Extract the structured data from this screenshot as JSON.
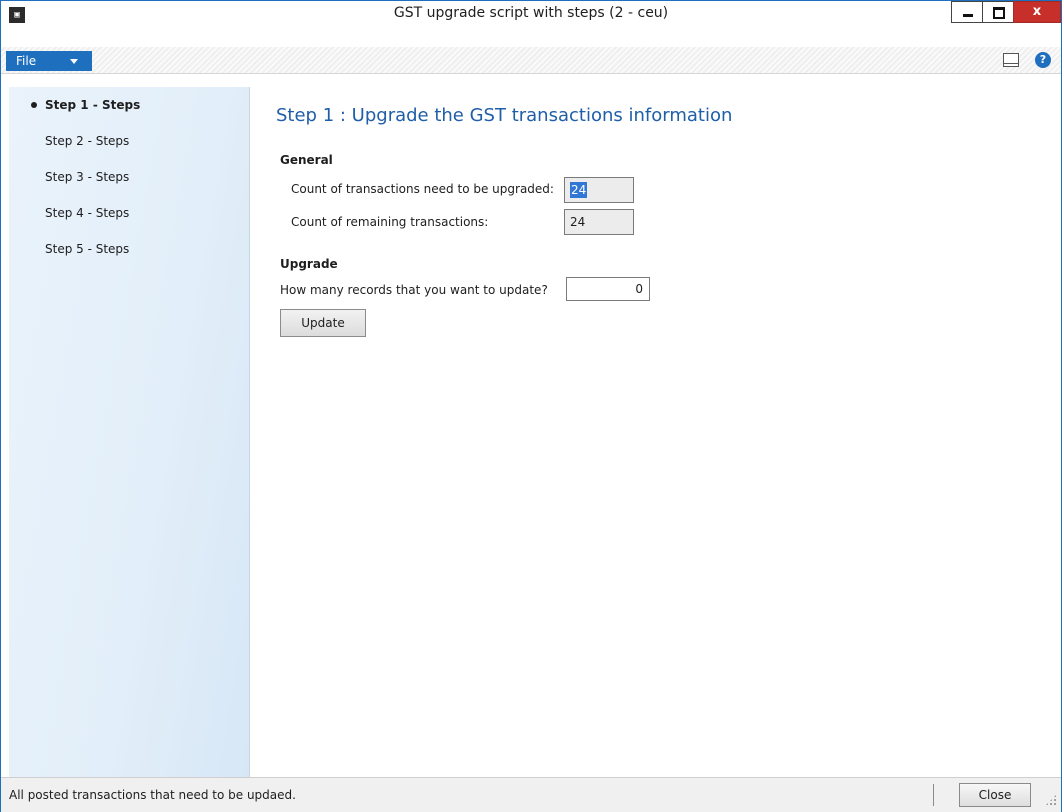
{
  "window": {
    "title": "GST upgrade script with steps (2 - ceu)",
    "app_icon": "app-icon",
    "controls": {
      "close_label": "x"
    }
  },
  "menu": {
    "file_label": "File",
    "right_icons": [
      "layout-icon",
      "help-icon"
    ],
    "help_glyph": "?"
  },
  "sidebar": {
    "items": [
      {
        "label": "Step 1 - Steps",
        "active": true
      },
      {
        "label": "Step 2 - Steps",
        "active": false
      },
      {
        "label": "Step 3 - Steps",
        "active": false
      },
      {
        "label": "Step 4 - Steps",
        "active": false
      },
      {
        "label": "Step 5 - Steps",
        "active": false
      }
    ]
  },
  "main": {
    "title": "Step 1 : Upgrade the GST transactions information",
    "general": {
      "heading": "General",
      "count_label": "Count of transactions need to be upgraded:",
      "count_value": "24",
      "remaining_label": "Count of remaining transactions:",
      "remaining_value": "24"
    },
    "upgrade": {
      "heading": "Upgrade",
      "records_label": "How many records that you want to update?",
      "records_value": "0",
      "update_button": "Update"
    }
  },
  "statusbar": {
    "message": "All posted transactions that need to be updaed.",
    "close_button": "Close"
  },
  "colors": {
    "accent": "#1f6fbf",
    "title_blue": "#1f5ea8",
    "close_red": "#c7302a",
    "selection": "#3377d6"
  }
}
